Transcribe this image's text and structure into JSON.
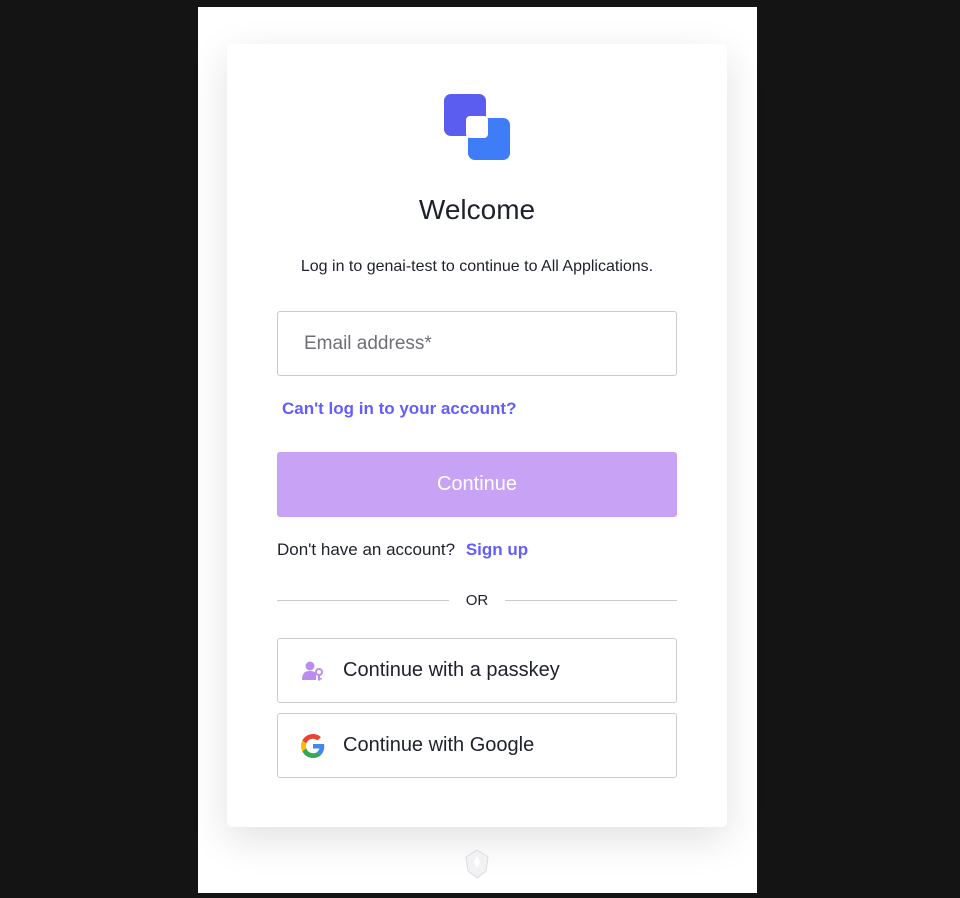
{
  "login": {
    "title": "Welcome",
    "subtitle": "Log in to genai-test to continue to All Applications.",
    "email_placeholder": "Email address*",
    "email_value": "",
    "forgot_link": "Can't log in to your account?",
    "continue_label": "Continue",
    "signup_prompt": "Don't have an account?",
    "signup_link": "Sign up",
    "divider_text": "OR",
    "passkey_label": "Continue with a passkey",
    "google_label": "Continue with Google"
  },
  "icons": {
    "logo": "overlapping-squares-logo",
    "passkey": "person-key-icon",
    "google": "google-g-icon",
    "footer": "shield-badge-icon"
  },
  "colors": {
    "accent": "#635dff",
    "continue_button": "#c8a2f5",
    "logo_primary": "#5b5cf0",
    "logo_secondary": "#3b82f6"
  }
}
